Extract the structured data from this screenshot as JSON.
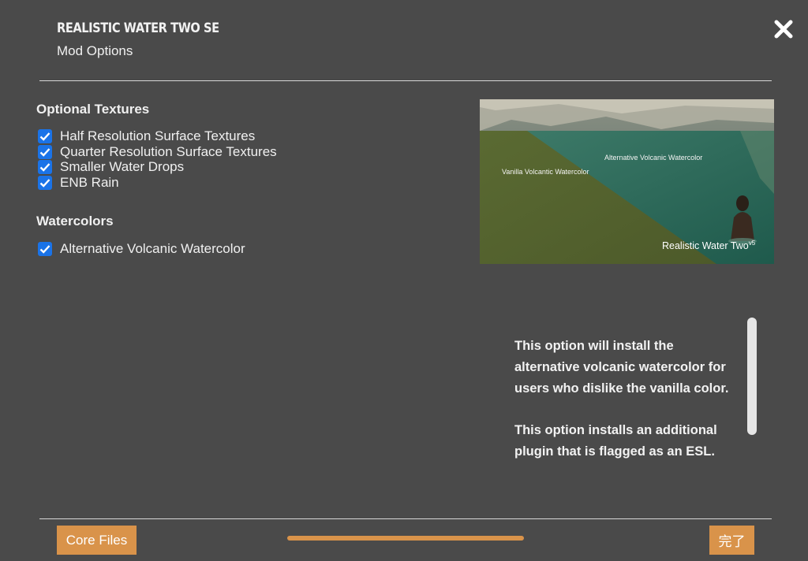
{
  "header": {
    "title": "REALISTIC WATER TWO SE",
    "subtitle": "Mod Options"
  },
  "close_icon": "close-icon",
  "groups": [
    {
      "title": "Optional Textures",
      "options": [
        {
          "label": "Half Resolution Surface Textures",
          "checked": true
        },
        {
          "label": "Quarter Resolution Surface Textures",
          "checked": true
        },
        {
          "label": "Smaller Water Drops",
          "checked": true
        },
        {
          "label": "ENB Rain",
          "checked": true
        }
      ]
    },
    {
      "title": "Watercolors",
      "options": [
        {
          "label": "Alternative Volcanic Watercolor",
          "checked": true
        }
      ]
    }
  ],
  "preview": {
    "label_vanilla": "Vanilla Volcantic Watercolor",
    "label_alt": "Alternative Volcanic Watercolor",
    "brand": "Realistic Water Two",
    "brand_sup": "v5"
  },
  "description": {
    "paragraph1": "This option will install the alternative volcanic watercolor for users who dislike the vanilla color.",
    "paragraph2": "This option installs an additional plugin that is flagged as an ESL."
  },
  "footer": {
    "back_label": "Core Files",
    "finish_label": "完了",
    "progress": 1.0
  },
  "colors": {
    "background": "#4a4a4a",
    "accent": "#d9934a",
    "checkbox": "#1a73e8"
  }
}
